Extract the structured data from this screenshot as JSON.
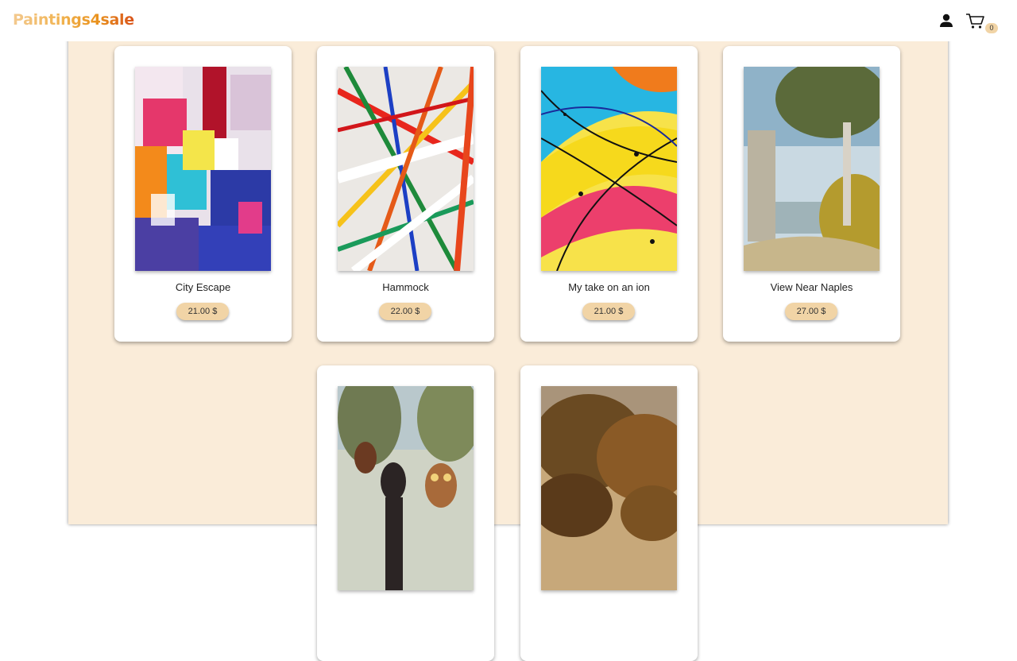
{
  "header": {
    "logo": "Paintings4sale",
    "user_icon": "person-icon",
    "cart_icon": "shopping-cart-icon",
    "cart_count": "0"
  },
  "theme": {
    "panel_bg": "#faecd9",
    "price_bg": "#f1d4a6",
    "logo_gradient": [
      "#f3c98f",
      "#f1b350",
      "#e9921e",
      "#d9531a"
    ]
  },
  "products": [
    {
      "title": "City Escape",
      "price": "21.00 $"
    },
    {
      "title": "Hammock",
      "price": "22.00 $"
    },
    {
      "title": "My take on an ion",
      "price": "21.00 $"
    },
    {
      "title": "View Near Naples",
      "price": "27.00 $"
    },
    {
      "title": "",
      "price": ""
    },
    {
      "title": "",
      "price": ""
    }
  ]
}
